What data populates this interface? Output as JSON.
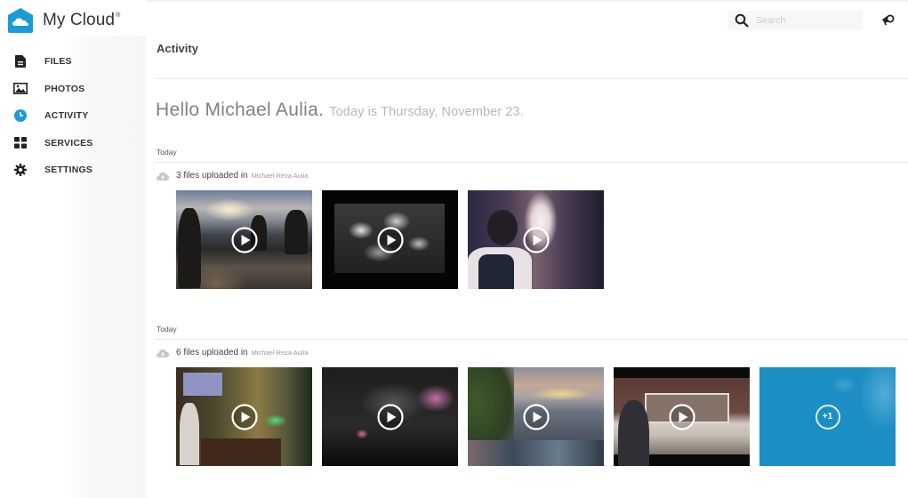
{
  "app": {
    "name": "My Cloud",
    "trademark": "®",
    "brand_color": "#1a9bd7"
  },
  "sidebar": {
    "items": [
      {
        "label": "FILES",
        "icon": "file-icon",
        "active": false
      },
      {
        "label": "PHOTOS",
        "icon": "photo-icon",
        "active": false
      },
      {
        "label": "ACTIVITY",
        "icon": "clock-icon",
        "active": true
      },
      {
        "label": "SERVICES",
        "icon": "grid-icon",
        "active": false
      },
      {
        "label": "SETTINGS",
        "icon": "gear-icon",
        "active": false
      }
    ]
  },
  "header": {
    "search_placeholder": "Search",
    "search_value": "",
    "announce_icon": "megaphone-icon"
  },
  "page": {
    "title": "Activity",
    "greeting": "Hello Michael Aulia.",
    "date_text": "Today is Thursday, November 23."
  },
  "activity_groups": [
    {
      "date_label": "Today",
      "count_text": "3 files uploaded in",
      "location": "Michael Reza Aulia",
      "items": [
        {
          "type": "video",
          "scene": "mountain sunset with people"
        },
        {
          "type": "video",
          "scene": "black and white crowd"
        },
        {
          "type": "video",
          "scene": "alley with backpacker"
        }
      ]
    },
    {
      "date_label": "Today",
      "count_text": "6 files uploaded in",
      "location": "Michael Reza Aulia",
      "items": [
        {
          "type": "video",
          "scene": "church stage"
        },
        {
          "type": "video",
          "scene": "fireworks at night"
        },
        {
          "type": "video",
          "scene": "coastal sunset"
        },
        {
          "type": "video",
          "scene": "kitchen with woman"
        },
        {
          "type": "more",
          "label": "+1"
        }
      ]
    }
  ]
}
